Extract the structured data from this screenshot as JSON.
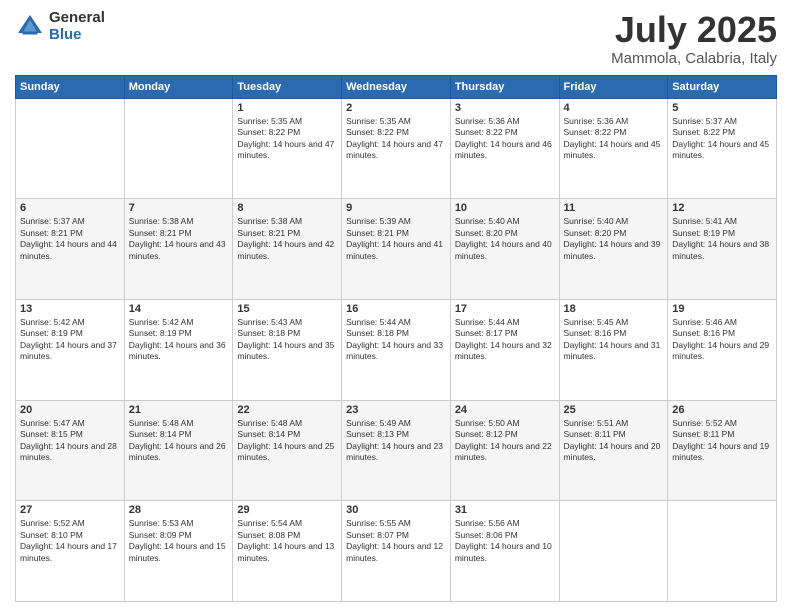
{
  "logo": {
    "general": "General",
    "blue": "Blue"
  },
  "title": {
    "month": "July 2025",
    "location": "Mammola, Calabria, Italy"
  },
  "weekdays": [
    "Sunday",
    "Monday",
    "Tuesday",
    "Wednesday",
    "Thursday",
    "Friday",
    "Saturday"
  ],
  "weeks": [
    [
      {
        "day": "",
        "info": ""
      },
      {
        "day": "",
        "info": ""
      },
      {
        "day": "1",
        "info": "Sunrise: 5:35 AM\nSunset: 8:22 PM\nDaylight: 14 hours and 47 minutes."
      },
      {
        "day": "2",
        "info": "Sunrise: 5:35 AM\nSunset: 8:22 PM\nDaylight: 14 hours and 47 minutes."
      },
      {
        "day": "3",
        "info": "Sunrise: 5:36 AM\nSunset: 8:22 PM\nDaylight: 14 hours and 46 minutes."
      },
      {
        "day": "4",
        "info": "Sunrise: 5:36 AM\nSunset: 8:22 PM\nDaylight: 14 hours and 45 minutes."
      },
      {
        "day": "5",
        "info": "Sunrise: 5:37 AM\nSunset: 8:22 PM\nDaylight: 14 hours and 45 minutes."
      }
    ],
    [
      {
        "day": "6",
        "info": "Sunrise: 5:37 AM\nSunset: 8:21 PM\nDaylight: 14 hours and 44 minutes."
      },
      {
        "day": "7",
        "info": "Sunrise: 5:38 AM\nSunset: 8:21 PM\nDaylight: 14 hours and 43 minutes."
      },
      {
        "day": "8",
        "info": "Sunrise: 5:38 AM\nSunset: 8:21 PM\nDaylight: 14 hours and 42 minutes."
      },
      {
        "day": "9",
        "info": "Sunrise: 5:39 AM\nSunset: 8:21 PM\nDaylight: 14 hours and 41 minutes."
      },
      {
        "day": "10",
        "info": "Sunrise: 5:40 AM\nSunset: 8:20 PM\nDaylight: 14 hours and 40 minutes."
      },
      {
        "day": "11",
        "info": "Sunrise: 5:40 AM\nSunset: 8:20 PM\nDaylight: 14 hours and 39 minutes."
      },
      {
        "day": "12",
        "info": "Sunrise: 5:41 AM\nSunset: 8:19 PM\nDaylight: 14 hours and 38 minutes."
      }
    ],
    [
      {
        "day": "13",
        "info": "Sunrise: 5:42 AM\nSunset: 8:19 PM\nDaylight: 14 hours and 37 minutes."
      },
      {
        "day": "14",
        "info": "Sunrise: 5:42 AM\nSunset: 8:19 PM\nDaylight: 14 hours and 36 minutes."
      },
      {
        "day": "15",
        "info": "Sunrise: 5:43 AM\nSunset: 8:18 PM\nDaylight: 14 hours and 35 minutes."
      },
      {
        "day": "16",
        "info": "Sunrise: 5:44 AM\nSunset: 8:18 PM\nDaylight: 14 hours and 33 minutes."
      },
      {
        "day": "17",
        "info": "Sunrise: 5:44 AM\nSunset: 8:17 PM\nDaylight: 14 hours and 32 minutes."
      },
      {
        "day": "18",
        "info": "Sunrise: 5:45 AM\nSunset: 8:16 PM\nDaylight: 14 hours and 31 minutes."
      },
      {
        "day": "19",
        "info": "Sunrise: 5:46 AM\nSunset: 8:16 PM\nDaylight: 14 hours and 29 minutes."
      }
    ],
    [
      {
        "day": "20",
        "info": "Sunrise: 5:47 AM\nSunset: 8:15 PM\nDaylight: 14 hours and 28 minutes."
      },
      {
        "day": "21",
        "info": "Sunrise: 5:48 AM\nSunset: 8:14 PM\nDaylight: 14 hours and 26 minutes."
      },
      {
        "day": "22",
        "info": "Sunrise: 5:48 AM\nSunset: 8:14 PM\nDaylight: 14 hours and 25 minutes."
      },
      {
        "day": "23",
        "info": "Sunrise: 5:49 AM\nSunset: 8:13 PM\nDaylight: 14 hours and 23 minutes."
      },
      {
        "day": "24",
        "info": "Sunrise: 5:50 AM\nSunset: 8:12 PM\nDaylight: 14 hours and 22 minutes."
      },
      {
        "day": "25",
        "info": "Sunrise: 5:51 AM\nSunset: 8:11 PM\nDaylight: 14 hours and 20 minutes."
      },
      {
        "day": "26",
        "info": "Sunrise: 5:52 AM\nSunset: 8:11 PM\nDaylight: 14 hours and 19 minutes."
      }
    ],
    [
      {
        "day": "27",
        "info": "Sunrise: 5:52 AM\nSunset: 8:10 PM\nDaylight: 14 hours and 17 minutes."
      },
      {
        "day": "28",
        "info": "Sunrise: 5:53 AM\nSunset: 8:09 PM\nDaylight: 14 hours and 15 minutes."
      },
      {
        "day": "29",
        "info": "Sunrise: 5:54 AM\nSunset: 8:08 PM\nDaylight: 14 hours and 13 minutes."
      },
      {
        "day": "30",
        "info": "Sunrise: 5:55 AM\nSunset: 8:07 PM\nDaylight: 14 hours and 12 minutes."
      },
      {
        "day": "31",
        "info": "Sunrise: 5:56 AM\nSunset: 8:06 PM\nDaylight: 14 hours and 10 minutes."
      },
      {
        "day": "",
        "info": ""
      },
      {
        "day": "",
        "info": ""
      }
    ]
  ]
}
